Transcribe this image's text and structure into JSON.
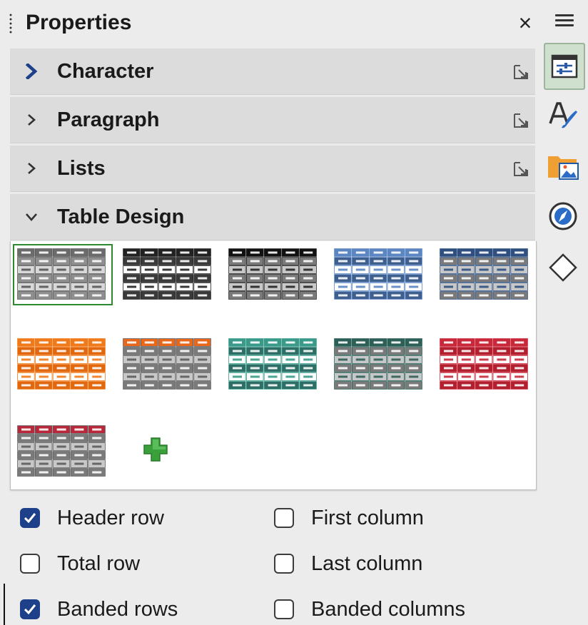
{
  "panel": {
    "title": "Properties",
    "close_glyph": "×",
    "menu_icon": "hamburger-menu-icon"
  },
  "sections": [
    {
      "label": "Character",
      "expanded": false,
      "accent": true,
      "has_more": true
    },
    {
      "label": "Paragraph",
      "expanded": false,
      "has_more": true
    },
    {
      "label": "Lists",
      "expanded": false,
      "has_more": true
    },
    {
      "label": "Table Design",
      "expanded": true,
      "has_more": false
    }
  ],
  "table_styles": [
    {
      "id": "default",
      "header": "#6b6b6b",
      "band": "#8f8f8f",
      "plain": "#d8d8d8",
      "line": "#555555",
      "selected": true
    },
    {
      "id": "black1",
      "header": "#222222",
      "band": "#3a3a3a",
      "plain": "#ffffff",
      "line": "#222222"
    },
    {
      "id": "black2",
      "header": "#111111",
      "band": "#7a7a7a",
      "plain": "#c8c8c8",
      "line": "#222222"
    },
    {
      "id": "blue",
      "header": "#5b86c2",
      "band": "#3f5f8f",
      "plain": "#ffffff",
      "line": "#5b86c2"
    },
    {
      "id": "darkblue",
      "header": "#2e4f80",
      "band": "#7a7a7a",
      "plain": "#c8c8c8",
      "line": "#2e4f80"
    },
    {
      "id": "orange",
      "header": "#f07a1a",
      "band": "#e06810",
      "plain": "#ffffff",
      "line": "#f07a1a"
    },
    {
      "id": "orange-gray",
      "header": "#e8671a",
      "band": "#7a7a7a",
      "plain": "#c8c8c8",
      "line": "#5b5b5b"
    },
    {
      "id": "turquoise",
      "header": "#3a9a8a",
      "band": "#2e6e66",
      "plain": "#ffffff",
      "line": "#3a9a8a"
    },
    {
      "id": "dark-teal",
      "header": "#2c5f56",
      "band": "#7a7a7a",
      "plain": "#c8c8c8",
      "line": "#2c5f56"
    },
    {
      "id": "red",
      "header": "#c8283a",
      "band": "#b0202e",
      "plain": "#ffffff",
      "line": "#c8283a"
    },
    {
      "id": "red-gray",
      "header": "#b8283a",
      "band": "#7a7a7a",
      "plain": "#c8c8c8",
      "line": "#5b5b5b"
    }
  ],
  "options": [
    {
      "label": "Header row",
      "checked": true
    },
    {
      "label": "First column",
      "checked": false
    },
    {
      "label": "Total row",
      "checked": false
    },
    {
      "label": "Last column",
      "checked": false
    },
    {
      "label": "Banded rows",
      "checked": true
    },
    {
      "label": "Banded columns",
      "checked": false
    }
  ],
  "tabs": [
    {
      "icon": "properties-icon",
      "active": true
    },
    {
      "icon": "styles-icon",
      "active": false
    },
    {
      "icon": "gallery-icon",
      "active": false
    },
    {
      "icon": "navigator-icon",
      "active": false
    },
    {
      "icon": "shapes-icon",
      "active": false
    }
  ],
  "colors": {
    "accent": "#1e3f8a",
    "selection": "#2e8a2e",
    "add": "#3aa13a"
  }
}
